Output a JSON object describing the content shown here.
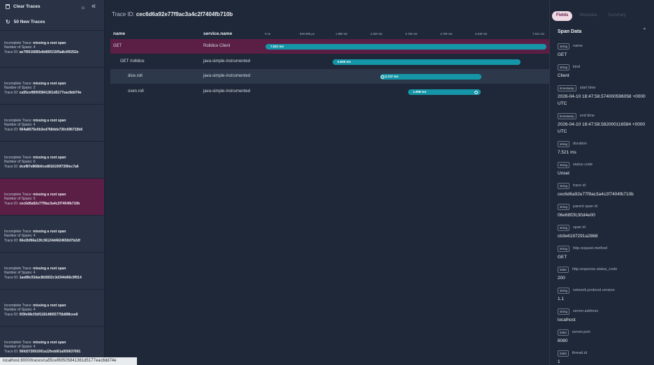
{
  "sidebar": {
    "clear_label": "Clear Traces",
    "new_traces_label": "50 New Traces",
    "traces": [
      {
        "status": "Incomplete Trace:",
        "msg": "missing a root span",
        "spans_label": "Number of Spans:",
        "spans": "4",
        "id_label": "Trace ID:",
        "id": "ae7f0016685e8d85f215f5a8c6f0252e"
      },
      {
        "status": "Incomplete Trace:",
        "msg": "missing a root span",
        "spans_label": "Number of Spans:",
        "spans": "2",
        "id_label": "Trace ID:",
        "id": "ca55cef80505841361d5177eac8dd74e"
      },
      {
        "status": "Incomplete Trace:",
        "msg": "missing a root span",
        "spans_label": "Number of Spans:",
        "spans": "4",
        "id_label": "Trace ID:",
        "id": "064a8075e0b3ed768dde730c696715b6"
      },
      {
        "status": "Incomplete Trace:",
        "msg": "missing a root span",
        "spans_label": "Number of Spans:",
        "spans": "6",
        "id_label": "Trace ID:",
        "id": "dcef87e868b0ced816100f7390ec7a6"
      },
      {
        "status": "Incomplete Trace:",
        "msg": "missing a root span",
        "spans_label": "Number of Spans:",
        "spans": "5",
        "id_label": "Trace ID:",
        "id": "cec6d6a92e77f9ac3a4c2f7404fb710b"
      },
      {
        "status": "Incomplete Trace:",
        "msg": "missing a root span",
        "spans_label": "Number of Spans:",
        "spans": "4",
        "id_label": "Trace ID:",
        "id": "66e2bf66a13fc36124d4624650d7b2df"
      },
      {
        "status": "Incomplete Trace:",
        "msg": "missing a root span",
        "spans_label": "Number of Spans:",
        "spans": "4",
        "id_label": "Trace ID:",
        "id": "1ae89c03dac8b5832c3d344d66c9f014"
      },
      {
        "status": "Incomplete Trace:",
        "msg": "missing a root span",
        "spans_label": "Number of Spans:",
        "spans": "4",
        "id_label": "Trace ID:",
        "id": "0f3fe68cf3df1181480f2775b898cee8"
      },
      {
        "status": "Incomplete Trace:",
        "msg": "missing a root span",
        "spans_label": "Number of Spans:",
        "spans": "4",
        "id_label": "Trace ID:",
        "id": "56fd372691001a12fedd61a950637691"
      }
    ]
  },
  "main": {
    "title_prefix": "Trace ID:",
    "trace_id": "cec6d6a92e77f9ac3a4c2f7404fb710b",
    "col_name": "name",
    "col_service": "service.name",
    "ticks": [
      "0 ns",
      "940.066 µs",
      "1.880 ms",
      "2.820 ms",
      "3.760 ms",
      "4.700 ms",
      "5.640 ms",
      "7.521 ms"
    ],
    "spans": [
      {
        "name": "GET",
        "service": "Rolldice Client",
        "duration": "7.521 ms"
      },
      {
        "name": "GET /rolldice",
        "service": "java-simple-instrumented",
        "duration": "5.605 ms"
      },
      {
        "name": "dice.roll",
        "service": "java-simple-instrumented",
        "duration": "3.747 ms"
      },
      {
        "name": "oven.roll",
        "service": "java-simple-instrumented",
        "duration": "1.098 ms"
      }
    ]
  },
  "panel": {
    "tabs": [
      "Fields",
      "Metadata",
      "Summary"
    ],
    "heading": "Span Data",
    "fields": [
      {
        "type": "string",
        "key": "name",
        "value": "GET"
      },
      {
        "type": "string",
        "key": "kind",
        "value": "Client"
      },
      {
        "type": "timestamp",
        "key": "start time",
        "value": "2026-04-10 18:47:58.574000596058 +0000 UTC"
      },
      {
        "type": "timestamp",
        "key": "end time",
        "value": "2026-04-10 18:47:58.582000116584 +0000 UTC"
      },
      {
        "type": "string",
        "key": "duration",
        "value": "7.521 ms"
      },
      {
        "type": "string",
        "key": "status code",
        "value": "Unset"
      },
      {
        "type": "string",
        "key": "trace id",
        "value": "cec6d6a92e77f9ac3a4c2f7404fb710b"
      },
      {
        "type": "string",
        "key": "parent span id",
        "value": "06e68f2fc30d4e00"
      },
      {
        "type": "string",
        "key": "span id",
        "value": "cb3e6187291a2868"
      },
      {
        "type": "string",
        "key": "http.request.method",
        "value": "GET"
      },
      {
        "type": "int64",
        "key": "http.response.status_code",
        "value": "200"
      },
      {
        "type": "string",
        "key": "network.protocol.version",
        "value": "1.1"
      },
      {
        "type": "string",
        "key": "server.address",
        "value": "localhost"
      },
      {
        "type": "int64",
        "key": "server.port",
        "value": "8080"
      },
      {
        "type": "int64",
        "key": "thread.id",
        "value": "1"
      }
    ]
  },
  "statusbar": {
    "url": "localhost:8000/traces/ca55cef80505841361d5177eac8dd74e"
  }
}
